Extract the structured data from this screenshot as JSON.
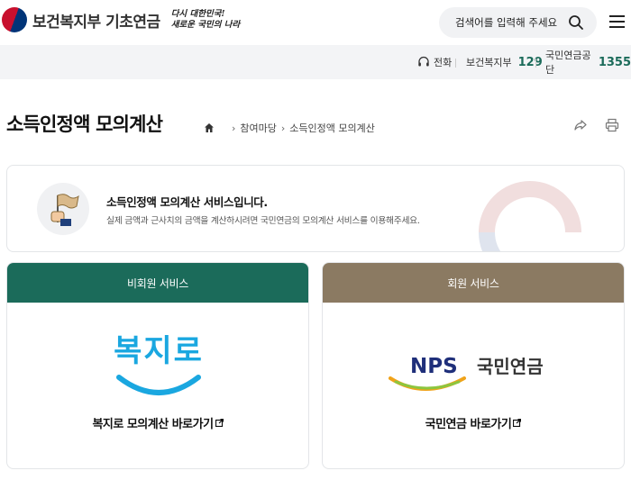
{
  "header": {
    "org_name": "보건복지부 기초연금",
    "slogan_line1": "다시 대한민국!",
    "slogan_line2": "새로운 국민의 나라",
    "search_placeholder": "검색어를 입력해 주세요"
  },
  "contact": {
    "phone_label": "전화",
    "items": [
      {
        "name": "보건복지부",
        "number": "129"
      },
      {
        "name": "국민연금공단",
        "number": "1355"
      }
    ]
  },
  "page": {
    "title": "소득인정액 모의계산",
    "breadcrumb": [
      "참여마당",
      "소득인정액 모의계산"
    ]
  },
  "info": {
    "title": "소득인정액 모의계산 서비스입니다.",
    "description": "실제 금액과 근사치의 금액을 계산하시려면 국민연금의 모의계산 서비스를 이용해주세요."
  },
  "cards": [
    {
      "header": "비회원 서비스",
      "logo_text": "복지로",
      "link_label": "복지로 모의계산 바로가기",
      "header_color": "#1b6b5a"
    },
    {
      "header": "회원 서비스",
      "logo_text": "NPS",
      "logo_subtext": "국민연금",
      "link_label": "국민연금 바로가기",
      "header_color": "#8b7a62"
    }
  ],
  "colors": {
    "accent_green": "#1b6b5a",
    "accent_brown": "#8b7a62",
    "bokjiro_blue": "#1aa7e0",
    "nps_navy": "#1f2f7a"
  }
}
